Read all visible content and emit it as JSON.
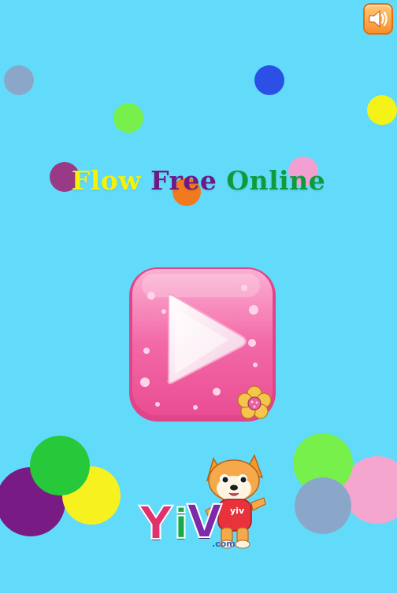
{
  "game": {
    "title_words": [
      {
        "text": "Flow",
        "color": "#f7f200"
      },
      {
        "text": "Free",
        "color": "#6b1a87"
      },
      {
        "text": "Online",
        "color": "#0c9c3c"
      }
    ]
  },
  "logo": {
    "letters": [
      {
        "text": "Y",
        "color": "#e0306e"
      },
      {
        "text": "i",
        "color": "#19a94a"
      },
      {
        "text": "V",
        "color": "#7d2aa9"
      }
    ],
    "suffix": ".com",
    "shirt_text": "yiv"
  },
  "colors": {
    "background": "#62dbfa",
    "play_button": "#f562a6",
    "sound_button": "#f7902c"
  },
  "icons": {
    "sound": "speaker-icon",
    "play": "play-icon",
    "flower": "flower-icon"
  }
}
